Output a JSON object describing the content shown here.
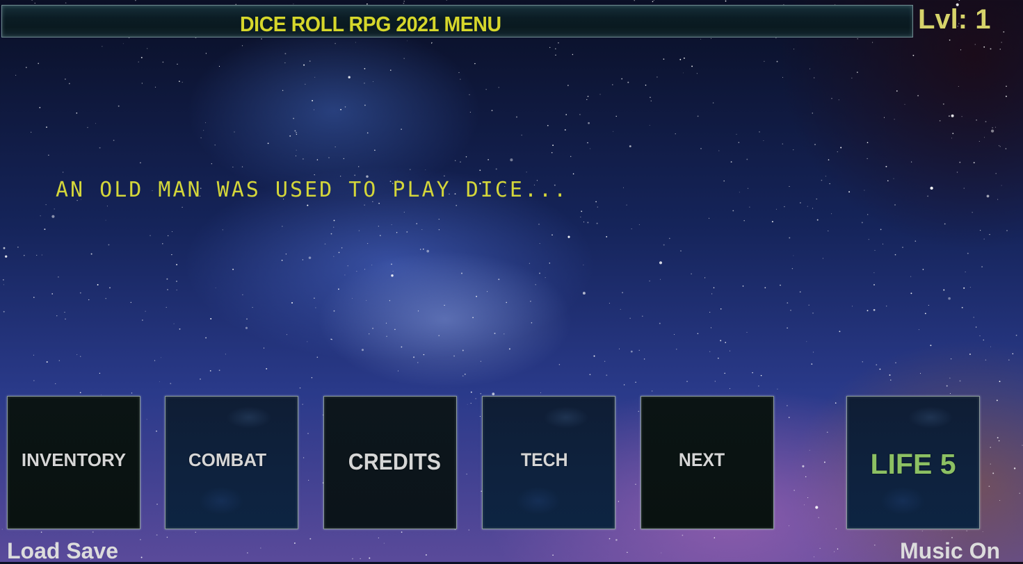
{
  "header": {
    "title": "DICE ROLL RPG 2021 MENU",
    "level_label": "Lvl: 1"
  },
  "story": {
    "text": "AN OLD MAN WAS USED TO PLAY DICE..."
  },
  "menu": {
    "inventory": "INVENTORY",
    "combat": "COMBAT",
    "credits": "CREDITS",
    "tech": "TECH",
    "next": "NEXT"
  },
  "status": {
    "life_label": "LIFE 5"
  },
  "footer": {
    "load_save": "Load Save",
    "music": "Music On"
  },
  "colors": {
    "title_yellow": "#d6d72b",
    "level_yellow": "#d6d36a",
    "story_yellow": "#d4d63a",
    "life_green": "#8cc063",
    "button_text": "#d6d6d6"
  }
}
